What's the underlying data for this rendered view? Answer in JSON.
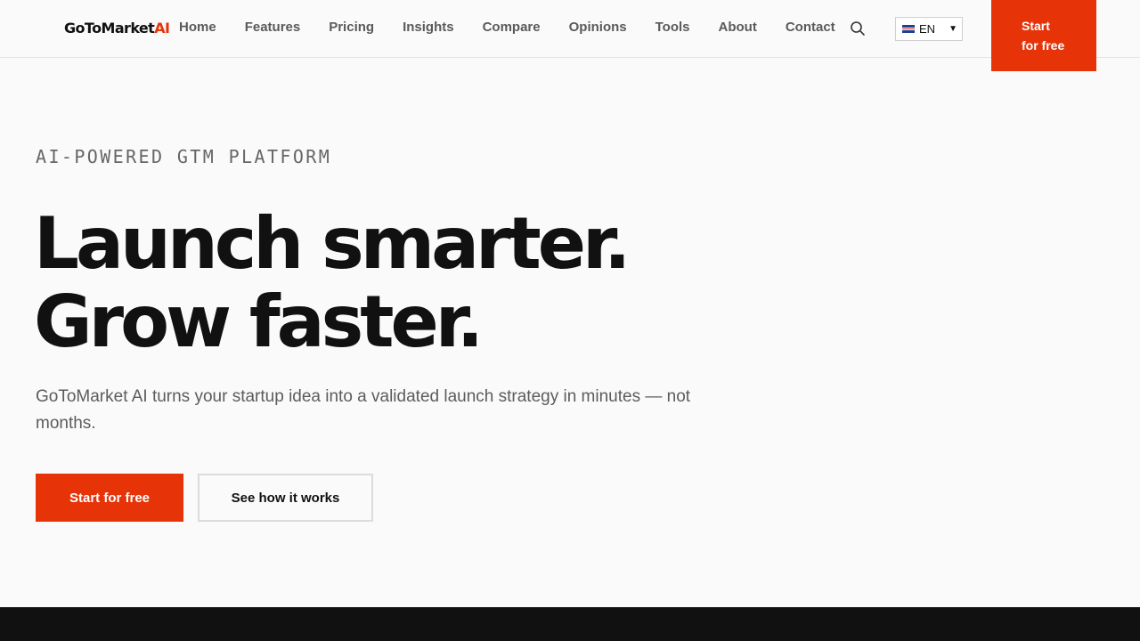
{
  "brand": {
    "name_main": "GoToMarket",
    "name_accent": "AI",
    "accent_color": "#e63308"
  },
  "nav": {
    "items": [
      {
        "label": "Home"
      },
      {
        "label": "Features"
      },
      {
        "label": "Pricing"
      },
      {
        "label": "Insights"
      },
      {
        "label": "Compare"
      },
      {
        "label": "Opinions"
      },
      {
        "label": "Tools"
      },
      {
        "label": "About"
      },
      {
        "label": "Contact"
      }
    ],
    "search_icon": "search-icon",
    "language": {
      "flag_icon": "uk-flag-icon",
      "selected": "EN"
    },
    "cta_label": "Start for free"
  },
  "hero": {
    "eyebrow": "AI-POWERED GTM PLATFORM",
    "headline_line1": "Launch smarter.",
    "headline_line2": "Grow faster.",
    "lede": "GoToMarket AI turns your startup idea into a validated launch strategy in minutes — not months.",
    "primary_cta": "Start for free",
    "secondary_cta": "See how it works"
  }
}
